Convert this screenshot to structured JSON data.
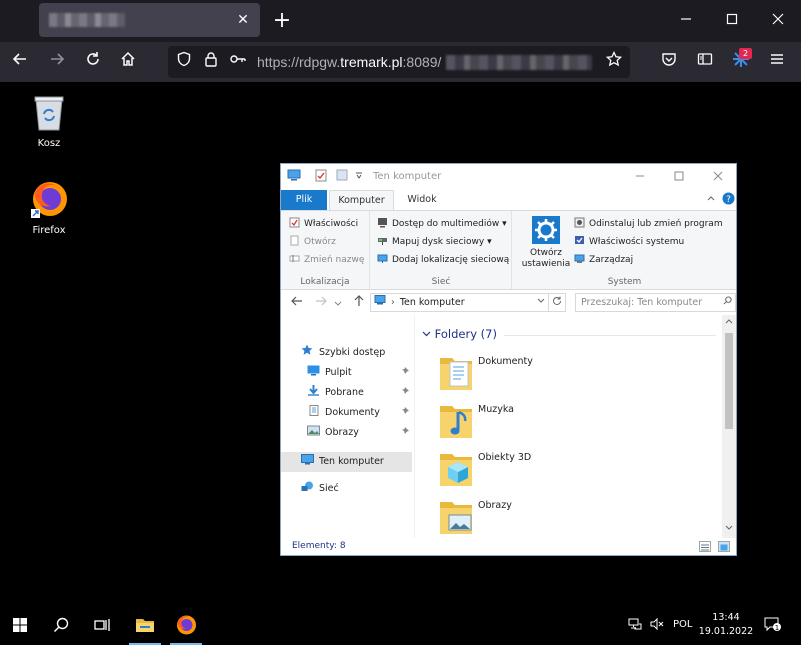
{
  "browser": {
    "tab_close": "✕",
    "new_tab": "+",
    "url_prefix": "https://rdpgw.",
    "url_domain": "tremark.pl",
    "url_port": ":8089/",
    "extension_badge": "2"
  },
  "desktop": {
    "icons": [
      {
        "label": "Kosz",
        "icon": "recycle-bin-icon"
      },
      {
        "label": "Firefox",
        "icon": "firefox-icon"
      }
    ]
  },
  "explorer": {
    "title": "Ten komputer",
    "tabs": {
      "file": "Plik",
      "computer": "Komputer",
      "view": "Widok"
    },
    "ribbon": {
      "location": {
        "name": "Lokalizacja",
        "properties": "Właściwości",
        "open": "Otwórz",
        "rename": "Zmień nazwę"
      },
      "network": {
        "name": "Sieć",
        "media": "Dostęp do multimediów",
        "map_drive": "Mapuj dysk sieciowy",
        "add_location": "Dodaj lokalizację sieciową"
      },
      "system": {
        "name": "System",
        "open_settings_1": "Otwórz",
        "open_settings_2": "ustawienia",
        "uninstall": "Odinstaluj lub zmień program",
        "system_props": "Właściwości systemu",
        "manage": "Zarządzaj"
      }
    },
    "address": "Ten komputer",
    "search_placeholder": "Przeszukaj: Ten komputer",
    "nav": {
      "quick_access": "Szybki dostęp",
      "desktop": "Pulpit",
      "downloads": "Pobrane",
      "documents": "Dokumenty",
      "pictures": "Obrazy",
      "this_pc": "Ten komputer",
      "network": "Sieć"
    },
    "group_header": "Foldery (7)",
    "folders": [
      {
        "name": "Dokumenty",
        "icon": "documents-folder-icon"
      },
      {
        "name": "Muzyka",
        "icon": "music-folder-icon"
      },
      {
        "name": "Obiekty 3D",
        "icon": "3d-objects-folder-icon"
      },
      {
        "name": "Obrazy",
        "icon": "pictures-folder-icon"
      }
    ],
    "status": "Elementy: 8"
  },
  "taskbar": {
    "language": "POL",
    "time": "13:44",
    "date": "19.01.2022",
    "notifications": "1"
  }
}
